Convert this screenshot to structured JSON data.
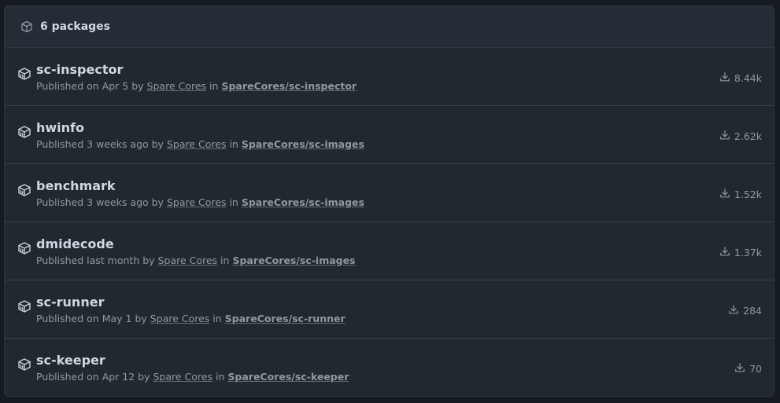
{
  "header": {
    "count_label": "6 packages",
    "icon": "package-icon"
  },
  "packages": [
    {
      "name": "sc-inspector",
      "published_prefix": "Published on Apr 5 by",
      "author": "Spare Cores",
      "in_label": "in",
      "repo": "SpareCores/sc-inspector",
      "downloads": "8.44k"
    },
    {
      "name": "hwinfo",
      "published_prefix": "Published 3 weeks ago by",
      "author": "Spare Cores",
      "in_label": "in",
      "repo": "SpareCores/sc-images",
      "downloads": "2.62k"
    },
    {
      "name": "benchmark",
      "published_prefix": "Published 3 weeks ago by",
      "author": "Spare Cores",
      "in_label": "in",
      "repo": "SpareCores/sc-images",
      "downloads": "1.52k"
    },
    {
      "name": "dmidecode",
      "published_prefix": "Published last month by",
      "author": "Spare Cores",
      "in_label": "in",
      "repo": "SpareCores/sc-images",
      "downloads": "1.37k"
    },
    {
      "name": "sc-runner",
      "published_prefix": "Published on May 1 by",
      "author": "Spare Cores",
      "in_label": "in",
      "repo": "SpareCores/sc-runner",
      "downloads": "284"
    },
    {
      "name": "sc-keeper",
      "published_prefix": "Published on Apr 12 by",
      "author": "Spare Cores",
      "in_label": "in",
      "repo": "SpareCores/sc-keeper",
      "downloads": "70"
    }
  ],
  "colors": {
    "background": "#212830",
    "header_background": "#262c36",
    "border": "#30363d",
    "text_primary": "#d1d7e0",
    "text_muted": "#9198a1"
  }
}
